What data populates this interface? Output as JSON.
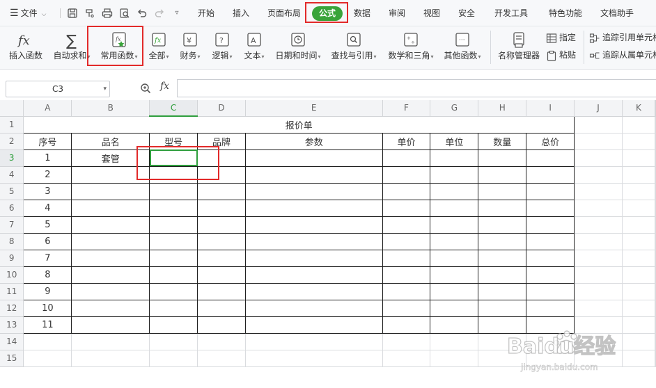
{
  "menubar": {
    "file_label": "文件",
    "tabs": [
      "开始",
      "插入",
      "页面布局",
      "公式",
      "数据",
      "审阅",
      "视图",
      "安全",
      "开发工具",
      "特色功能",
      "文档助手"
    ],
    "active_tab": "公式"
  },
  "ribbon": {
    "insert_function": "插入函数",
    "autosum": "自动求和",
    "common_functions": "常用函数",
    "all": "全部",
    "finance": "财务",
    "logic": "逻辑",
    "text": "文本",
    "datetime": "日期和时间",
    "lookup": "查找与引用",
    "math": "数学和三角",
    "other": "其他函数",
    "name_manager": "名称管理器",
    "define": "指定",
    "paste": "粘贴",
    "trace_precedents": "追踪引用单元格",
    "trace_dependents": "追踪从属单元格"
  },
  "formula_bar": {
    "name_box": "C3",
    "fx": "fx",
    "value": ""
  },
  "sheet": {
    "columns": [
      "A",
      "B",
      "C",
      "D",
      "E",
      "F",
      "G",
      "H",
      "I",
      "J",
      "K"
    ],
    "rows": [
      "1",
      "2",
      "3",
      "4",
      "5",
      "6",
      "7",
      "8",
      "9",
      "10",
      "11",
      "12",
      "13",
      "14",
      "15"
    ],
    "selected_cell": "C3",
    "title": "报价单",
    "headers": [
      "序号",
      "品名",
      "型号",
      "品牌",
      "参数",
      "单价",
      "单位",
      "数量",
      "总价"
    ],
    "data_rows": [
      [
        "1",
        "套管",
        "",
        "",
        "",
        "",
        "",
        "",
        ""
      ],
      [
        "2",
        "",
        "",
        "",
        "",
        "",
        "",
        "",
        ""
      ],
      [
        "3",
        "",
        "",
        "",
        "",
        "",
        "",
        "",
        ""
      ],
      [
        "4",
        "",
        "",
        "",
        "",
        "",
        "",
        "",
        ""
      ],
      [
        "5",
        "",
        "",
        "",
        "",
        "",
        "",
        "",
        ""
      ],
      [
        "6",
        "",
        "",
        "",
        "",
        "",
        "",
        "",
        ""
      ],
      [
        "7",
        "",
        "",
        "",
        "",
        "",
        "",
        "",
        ""
      ],
      [
        "8",
        "",
        "",
        "",
        "",
        "",
        "",
        "",
        ""
      ],
      [
        "9",
        "",
        "",
        "",
        "",
        "",
        "",
        "",
        ""
      ],
      [
        "10",
        "",
        "",
        "",
        "",
        "",
        "",
        "",
        ""
      ],
      [
        "11",
        "",
        "",
        "",
        "",
        "",
        "",
        "",
        ""
      ]
    ]
  },
  "colors": {
    "accent": "#3aa43a",
    "highlight_box": "#e22a2a",
    "table_border": "#1f1f1f"
  },
  "watermark": {
    "brand": "Baidu经验",
    "url": "jingyan.baidu.com"
  }
}
